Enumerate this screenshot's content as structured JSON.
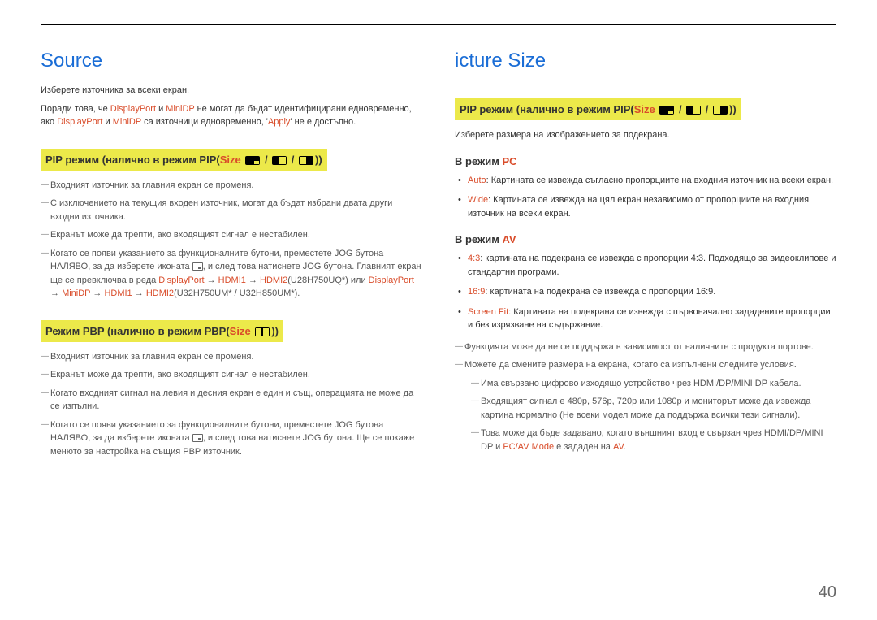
{
  "left": {
    "title": "Source",
    "p1": "Изберете източника за всеки екран.",
    "p2_a": "Поради това, че ",
    "p2_dp": "DisplayPort",
    "p2_b": " и ",
    "p2_mdp": "MiniDP",
    "p2_c": " не могат да бъдат идентифицирани едновременно, ако ",
    "p2_dp2": "DisplayPort",
    "p2_d": " и ",
    "p2_mdp2": "MiniDP",
    "p2_e": " са източници едновременно, '",
    "p2_apply": "Apply",
    "p2_f": "' не е достъпно.",
    "pip_label_a": "PIP режим (налично в режим PIP(",
    "pip_size": "Size",
    "pip_label_b": "))",
    "pip_list": {
      "i1": "Входният източник за главния екран се променя.",
      "i2": "С изключението на текущия входен източник, могат да бъдат избрани двата други входни източника.",
      "i3": "Екранът може да трепти, ако входящият сигнал е нестабилен.",
      "i4_a": "Когато се появи указанието за функционалните бутони, преместете JOG бутона НАЛЯВО, за да изберете иконата ",
      "i4_b": ", и след това натиснете JOG бутона. Главният екран ще се превключва в реда ",
      "i4_seq1_a": "DisplayPort",
      "i4_seq1_b": " → ",
      "i4_seq1_c": "HDMI1",
      "i4_seq1_d": " → ",
      "i4_seq1_e": "HDMI2",
      "i4_seq1_f": "(U28H750UQ*) или ",
      "i4_seq2_a": "DisplayPort",
      "i4_seq2_b": " → ",
      "i4_seq2_c": "MiniDP",
      "i4_seq2_d": " → ",
      "i4_seq2_e": "HDMI1",
      "i4_seq2_f": " → ",
      "i4_seq2_g": "HDMI2",
      "i4_seq2_h": "(U32H750UM* / U32H850UM*)."
    },
    "pbp_label_a": "Режим PBP (налично в режим PBP(",
    "pbp_size": "Size",
    "pbp_label_b": "))",
    "pbp_list": {
      "i1": "Входният източник за главния екран се променя.",
      "i2": "Екранът може да трепти, ако входящият сигнал е нестабилен.",
      "i3": "Когато входният сигнал на левия и десния екран е един и същ, операцията не може да се изпълни.",
      "i4_a": "Когато се появи указанието за функционалните бутони, преместете JOG бутона НАЛЯВО, за да изберете иконата ",
      "i4_b": ", и след това натиснете JOG бутона. Ще се покаже менюто за настройка на същия PBP източник."
    }
  },
  "right": {
    "title": "icture Size",
    "pip_label_a": "PIP режим (налично в режим PIP(",
    "pip_size": "Size",
    "pip_label_b": "))",
    "p1": "Изберете размера на изображението за подекрана.",
    "mode_pc_a": "В режим ",
    "mode_pc_b": "PC",
    "pc_list": {
      "i1_a": "Auto",
      "i1_b": ": Картината се извежда съгласно пропорциите на входния източник на всеки екран.",
      "i2_a": "Wide",
      "i2_b": ": Картината се извежда на цял екран независимо от пропорциите на входния източник на всеки екран."
    },
    "mode_av_a": "В режим ",
    "mode_av_b": "AV",
    "av_list": {
      "i1_a": "4:3",
      "i1_b": ": картината на подекрана се извежда с пропорции 4:3. Подходящо за видеоклипове и стандартни програми.",
      "i2_a": "16:9",
      "i2_b": ": картината на подекрана се извежда с пропорции 16:9.",
      "i3_a": "Screen Fit",
      "i3_b": ": Картината на подекрана се извежда с първоначално зададените пропорции и без изрязване на съдържание."
    },
    "notes": {
      "n1": "Функцията може да не се поддържа в зависимост от наличните с продукта портове.",
      "n2": "Можете да смените размера на екрана, когато са изпълнени следните условия.",
      "n2a": "Има свързано цифрово изходящо устройство чрез HDMI/DP/MINI DP кабела.",
      "n2b": "Входящият сигнал е 480p, 576p, 720p или 1080p и мониторът може да извежда картина нормално (Не всеки модел може да поддържа всички тези сигнали).",
      "n2c_a": "Това може да бъде задавано, когато външният вход е свързан чрез HDMI/DP/MINI DP и ",
      "n2c_b": "PC/AV Mode",
      "n2c_c": " е зададен на ",
      "n2c_d": "AV",
      "n2c_e": "."
    }
  },
  "page": "40"
}
